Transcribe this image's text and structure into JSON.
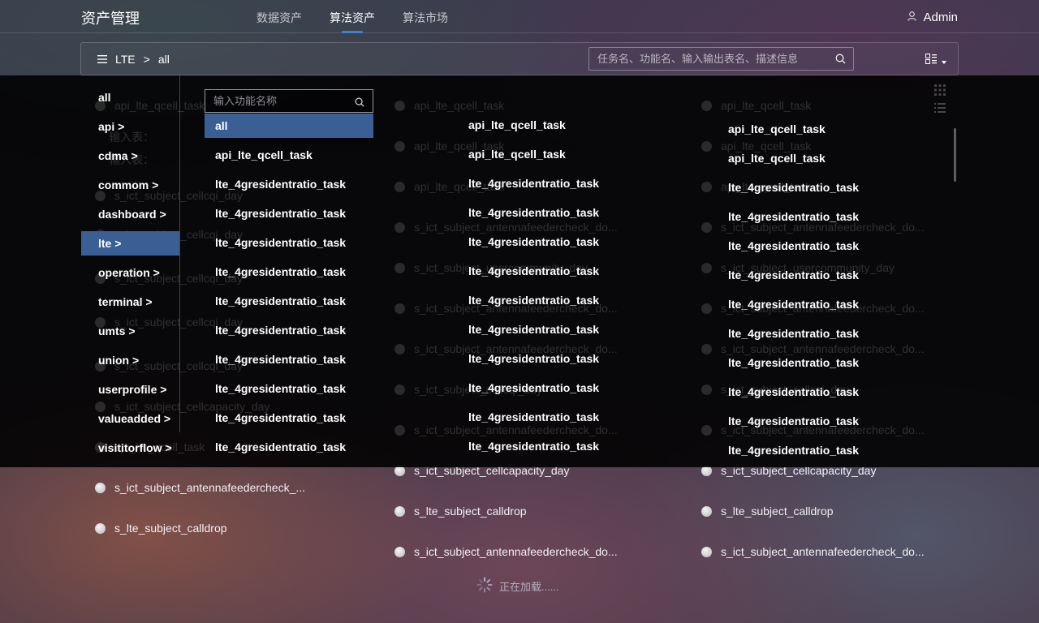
{
  "header": {
    "app_title": "资产管理",
    "nav": [
      "数据资产",
      "算法资产",
      "算法市场"
    ],
    "active_nav": "算法资产",
    "user": "Admin"
  },
  "toolbar": {
    "breadcrumb": [
      "LTE",
      "all"
    ],
    "search_placeholder": "任务名、功能名、输入输出表名、描述信息"
  },
  "background_list": {
    "col1": [
      "s_ict_subject_antennafeedercheck_...",
      "s_lte_subject_calldrop"
    ],
    "col2": [
      "s_ict_subject_cellcapacity_day",
      "s_lte_subject_calldrop",
      "s_ict_subject_antennafeedercheck_do..."
    ],
    "col3": [
      "s_ict_subject_cellcapacity_day",
      "s_lte_subject_calldrop",
      "s_ict_subject_antennafeedercheck_do..."
    ],
    "loading_text": "正在加载......"
  },
  "overlay": {
    "categories": [
      "all",
      "api  >",
      "cdma  >",
      "commom  >",
      "dashboard  >",
      "lte  >",
      "operation  >",
      "terminal  >",
      "umts  >",
      "union  >",
      "userprofile  >",
      "valueadded  >",
      "visititorflow  >"
    ],
    "active_category": "lte  >",
    "function_search_placeholder": "输入功能名称",
    "functions": [
      "all",
      "api_lte_qcell_task",
      "lte_4gresidentratio_task",
      "lte_4gresidentratio_task",
      "lte_4gresidentratio_task",
      "lte_4gresidentratio_task",
      "lte_4gresidentratio_task",
      "lte_4gresidentratio_task",
      "lte_4gresidentratio_task",
      "lte_4gresidentratio_task",
      "lte_4gresidentratio_task"
    ],
    "active_function": "all",
    "tasks_col2": [
      "api_lte_qcell_task",
      "api_lte_qcell_task",
      "lte_4gresidentratio_task",
      "lte_4gresidentratio_task",
      "lte_4gresidentratio_task",
      "lte_4gresidentratio_task",
      "lte_4gresidentratio_task",
      "lte_4gresidentratio_task",
      "lte_4gresidentratio_task",
      "lte_4gresidentratio_task",
      "lte_4gresidentratio_task",
      "lte_4gresidentratio_task"
    ],
    "tasks_col3": [
      "api_lte_qcell_task",
      "api_lte_qcell_task",
      "lte_4gresidentratio_task",
      "lte_4gresidentratio_task",
      "lte_4gresidentratio_task",
      "lte_4gresidentratio_task",
      "lte_4gresidentratio_task",
      "lte_4gresidentratio_task",
      "lte_4gresidentratio_task",
      "lte_4gresidentratio_task",
      "lte_4gresidentratio_task",
      "lte_4gresidentratio_task"
    ],
    "ghost_col1": [
      "api_lte_qcell_task",
      "输入表：",
      "输入表：",
      "s_ict_subject_cellcqi_day",
      "s_ict_subject_cellcqi_day",
      "s_ict_subject_cellcqi_day",
      "s_ict_subject_cellcqi_day",
      "s_ict_subject_cellcqi_day",
      "s_ict_subject_cellcapacity_day",
      "api_lte_qcell_task"
    ],
    "ghost_col2": [
      "api_lte_qcell_task",
      "api_lte_qcell_task",
      "api_lte_qcell_task",
      "s_ict_subject_antennafeedercheck_do...",
      "s_ict_subject_usercommunity_day",
      "s_ict_subject_antennafeedercheck_do...",
      "s_ict_subject_antennafeedercheck_do...",
      "s_ict_subject_cellcqi_day",
      "s_ict_subject_antennafeedercheck_do..."
    ],
    "ghost_col3": [
      "api_lte_qcell_task",
      "api_lte_qcell_task",
      "api_lte_qcell_task",
      "s_ict_subject_antennafeedercheck_do...",
      "s_ict_subject_usercommunity_day",
      "s_ict_subject_antennafeedercheck_do...",
      "s_ict_subject_antennafeedercheck_do...",
      "s_ict_subject_cellcqi_day",
      "s_ict_subject_antennafeedercheck_do..."
    ]
  }
}
